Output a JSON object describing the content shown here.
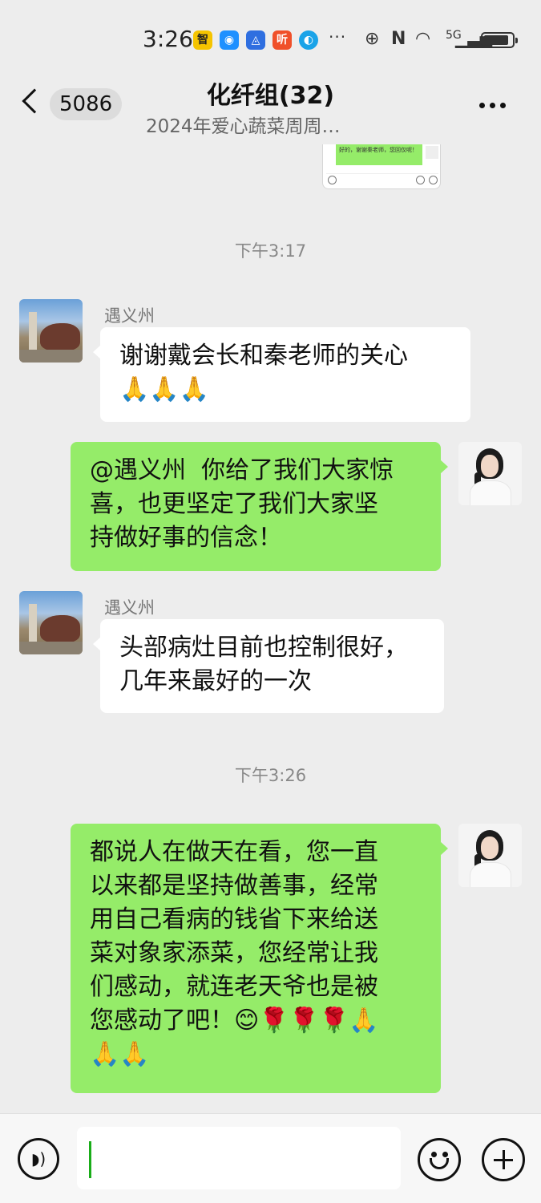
{
  "status_bar": {
    "time": "3:26",
    "apps": [
      {
        "icon": "app-yellow-icon",
        "glyph": "智",
        "color": "#f5c400"
      },
      {
        "icon": "app-chat-icon",
        "glyph": "◉",
        "color": "#1e90ff"
      },
      {
        "icon": "app-triangle-icon",
        "glyph": "◬",
        "color": "#2f6fe0"
      },
      {
        "icon": "app-ting-icon",
        "glyph": "听",
        "color": "#f0502a"
      },
      {
        "icon": "app-browser-icon",
        "glyph": "◐",
        "color": "#1aa3e8"
      }
    ],
    "more": "···",
    "network": "5G"
  },
  "header": {
    "unread_count": "5086",
    "title": "化纤组(32)",
    "subtitle": "2024年爱心蔬菜周周…"
  },
  "thumb": {
    "text": "好的，谢谢秦老师，您回仅呢！"
  },
  "messages": {
    "ts1": "下午3:17",
    "m1": {
      "sender": "遇义州",
      "text": "谢谢戴会长和秦老师的关心\n🙏🙏🙏"
    },
    "m2": {
      "text": "@遇义州  你给了我们大家惊\n喜，也更坚定了我们大家坚\n持做好事的信念！"
    },
    "m3": {
      "sender": "遇义州",
      "text": "头部病灶目前也控制很好，\n几年来最好的一次"
    },
    "ts2": "下午3:26",
    "m4": {
      "text": "都说人在做天在看，您一直\n以来都是坚持做善事，经常\n用自己看病的钱省下来给送\n菜对象家添菜，您经常让我\n们感动，就连老天爷也是被\n您感动了吧！😊🌹🌹🌹🙏\n🙏🙏"
    }
  },
  "input": {
    "value": ""
  }
}
